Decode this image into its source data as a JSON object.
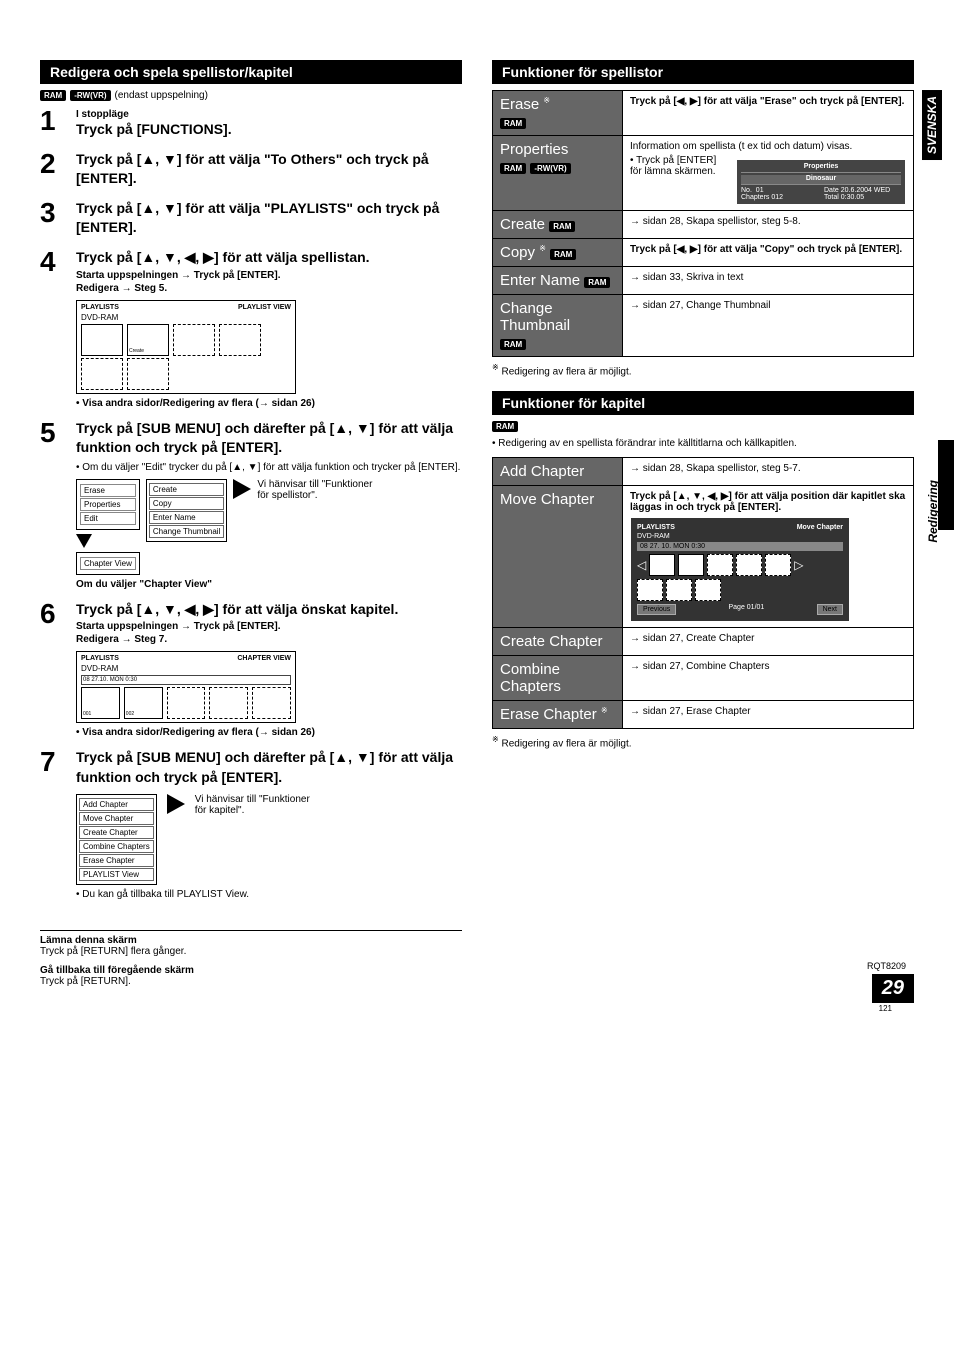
{
  "left": {
    "header": "Redigera och spela spellistor/kapitel",
    "disc_note": "(endast uppspelning)",
    "tags": {
      "ram": "RAM",
      "rwvr": "-RW(VR)"
    },
    "step1_sub": "I stoppläge",
    "step1_title": "Tryck på [FUNCTIONS].",
    "step2_title": "Tryck på [▲, ▼] för att välja \"To Others\" och tryck på [ENTER].",
    "step3_title": "Tryck på [▲, ▼] för att välja \"PLAYLISTS\" och tryck på [ENTER].",
    "step4_title": "Tryck på [▲, ▼, ◀, ▶] för att välja spellistan.",
    "step4_sub1": "Starta uppspelningen → Tryck på [ENTER].",
    "step4_sub2": "Redigera → Steg 5.",
    "step4_bullet": "Visa andra sidor/Redigering av flera (→ sidan 26)",
    "step4_fig": {
      "hdr_l": "PLAYLISTS",
      "hdr_r": "PLAYLIST VIEW",
      "disc": "DVD-RAM",
      "create": "Create"
    },
    "step5_title": "Tryck på [SUB MENU] och därefter på [▲, ▼] för att välja funktion och tryck på [ENTER].",
    "step5_bullet": "Om du väljer \"Edit\" trycker du på [▲, ▼] för att välja funktion och trycker på [ENTER].",
    "step5_left_items": [
      "Erase",
      "Properties",
      "Edit",
      "Chapter View"
    ],
    "step5_right_items": [
      "Create",
      "Copy",
      "Enter Name",
      "Change Thumbnail"
    ],
    "step5_note": "Vi hänvisar till \"Funktioner för spellistor\".",
    "step5_caption": "Om du väljer \"Chapter View\"",
    "step6_title": "Tryck på [▲, ▼, ◀, ▶] för att välja önskat kapitel.",
    "step6_sub1": "Starta uppspelningen → Tryck på [ENTER].",
    "step6_sub2": "Redigera → Steg 7.",
    "step6_fig": {
      "hdr_l": "PLAYLISTS",
      "hdr_r": "CHAPTER VIEW",
      "disc": "DVD-RAM",
      "sub": "08 27.10. MON 0:30",
      "n1": "001",
      "n2": "002"
    },
    "step6_bullet": "Visa andra sidor/Redigering av flera (→ sidan 26)",
    "step7_title": "Tryck på [SUB MENU] och därefter på [▲, ▼] för att välja funktion och tryck på [ENTER].",
    "step7_items": [
      "Add Chapter",
      "Move Chapter",
      "Create Chapter",
      "Combine Chapters",
      "Erase Chapter",
      "PLAYLIST View"
    ],
    "step7_note": "Vi hänvisar till \"Funktioner för kapitel\".",
    "step7_bullet": "Du kan gå tillbaka till PLAYLIST View.",
    "exit1_h": "Lämna denna skärm",
    "exit1_b": "Tryck på [RETURN] flera gånger.",
    "exit2_h": "Gå tillbaka till föregående skärm",
    "exit2_b": "Tryck på [RETURN]."
  },
  "right": {
    "header1": "Funktioner för spellistor",
    "erase": {
      "name": "Erase",
      "body": "Tryck på [◀, ▶] för att välja \"Erase\" och tryck på [ENTER]."
    },
    "properties": {
      "name": "Properties",
      "body1": "Information om spellista (t ex tid och datum) visas.",
      "body2": "Tryck på [ENTER] för lämna skärmen.",
      "box": {
        "title": "Properties",
        "sub": "Dinosaur",
        "no_l": "No.",
        "no_v": "01",
        "ch_l": "Chapters",
        "ch_v": "012",
        "date_l": "Date",
        "date_v": "20.6.2004 WED",
        "tot_l": "Total",
        "tot_v": "0:30.05"
      }
    },
    "create": {
      "name": "Create",
      "body": "→ sidan 28, Skapa spellistor, steg 5-8."
    },
    "copy": {
      "name": "Copy",
      "body": "Tryck på [◀, ▶] för att välja \"Copy\" och tryck på [ENTER]."
    },
    "enter_name": {
      "name": "Enter Name",
      "body": "→ sidan 33, Skriva in text"
    },
    "change_thumb": {
      "name": "Change Thumbnail",
      "body": "→ sidan 27, Change Thumbnail"
    },
    "footnote1": "Redigering av flera är möjligt.",
    "header2": "Funktioner för kapitel",
    "kap_note": "Redigering av en spellista förändrar inte källtitlarna och källkapitlen.",
    "add_chapter": {
      "name": "Add Chapter",
      "body": "→ sidan 28, Skapa spellistor, steg 5-7."
    },
    "move_chapter": {
      "name": "Move Chapter",
      "body": "Tryck på [▲, ▼, ◀, ▶] för att välja position där kapitlet ska läggas in och tryck på [ENTER].",
      "box": {
        "hdr_l": "PLAYLISTS",
        "hdr_r": "Move Chapter",
        "disc": "DVD-RAM",
        "sub": "08    27. 10. MON 0:30",
        "prev": "Previous",
        "page": "Page 01/01",
        "next": "Next"
      }
    },
    "create_chapter": {
      "name": "Create Chapter",
      "body": "→ sidan 27, Create Chapter"
    },
    "combine_chapters": {
      "name": "Combine Chapters",
      "body": "→ sidan 27, Combine Chapters"
    },
    "erase_chapter": {
      "name": "Erase Chapter",
      "body": "→ sidan 27, Erase Chapter"
    },
    "footnote2": "Redigering av flera är möjligt."
  },
  "side": {
    "svenska": "SVENSKA",
    "redigering": "Redigering"
  },
  "footer": {
    "code": "RQT8209",
    "page": "29",
    "under": "121"
  }
}
